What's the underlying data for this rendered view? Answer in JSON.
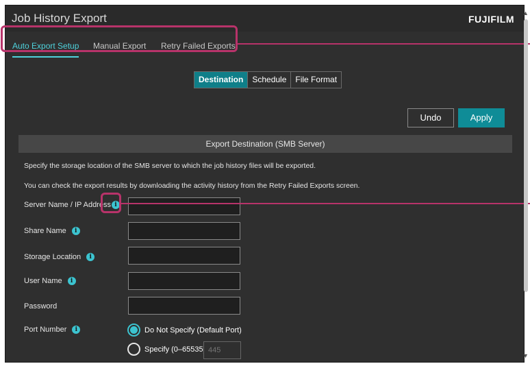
{
  "window": {
    "title": "Job History Export",
    "brand": "FUJIFILM"
  },
  "tabs": [
    {
      "label": "Auto Export Setup",
      "active": true
    },
    {
      "label": "Manual Export",
      "active": false
    },
    {
      "label": "Retry Failed Exports",
      "active": false
    }
  ],
  "segments": [
    {
      "label": "Destination",
      "active": true
    },
    {
      "label": "Schedule",
      "active": false
    },
    {
      "label": "File Format",
      "active": false
    }
  ],
  "buttons": {
    "undo": "Undo",
    "apply": "Apply"
  },
  "section": {
    "header": "Export Destination (SMB Server)",
    "description_1": "Specify the storage location of the SMB server to which the job history files will be exported.",
    "description_2": "You can check the export results by downloading the activity history from the Retry Failed Exports screen."
  },
  "fields": {
    "server": {
      "label": "Server Name / IP Address",
      "value": ""
    },
    "share": {
      "label": "Share Name",
      "value": ""
    },
    "storage": {
      "label": "Storage Location",
      "value": ""
    },
    "user": {
      "label": "User Name",
      "value": ""
    },
    "password": {
      "label": "Password",
      "value": ""
    }
  },
  "port": {
    "label": "Port Number",
    "option_default": "Do Not Specify (Default Port)",
    "option_specify": "Specify (0–65535)",
    "selected": "default",
    "placeholder": "445"
  },
  "colors": {
    "accent": "#0f8c97",
    "tab_active": "#4fd2dc",
    "highlight": "#b8336a",
    "background": "#2f2f2f"
  },
  "icons": {
    "info": "info-icon"
  }
}
